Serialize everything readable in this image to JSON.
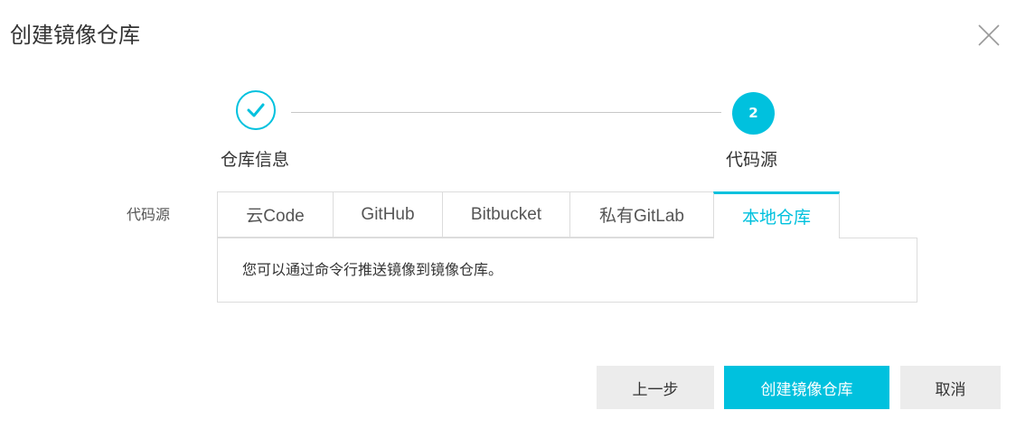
{
  "dialog": {
    "title": "创建镜像仓库"
  },
  "stepper": {
    "steps": [
      {
        "label": "仓库信息",
        "status": "done"
      },
      {
        "label": "代码源",
        "number": "2",
        "status": "active"
      }
    ]
  },
  "source": {
    "label": "代码源",
    "tabs": [
      {
        "label": "云Code"
      },
      {
        "label": "GitHub"
      },
      {
        "label": "Bitbucket"
      },
      {
        "label": "私有GitLab"
      },
      {
        "label": "本地仓库",
        "active": true
      }
    ],
    "panel_text": "您可以通过命令行推送镜像到镜像仓库。"
  },
  "footer": {
    "prev_label": "上一步",
    "create_label": "创建镜像仓库",
    "cancel_label": "取消"
  },
  "colors": {
    "accent": "#00c1de",
    "button_gray": "#ececec",
    "border": "#dcdcdc"
  },
  "icons": {
    "close": "close-icon",
    "check": "check-icon"
  }
}
